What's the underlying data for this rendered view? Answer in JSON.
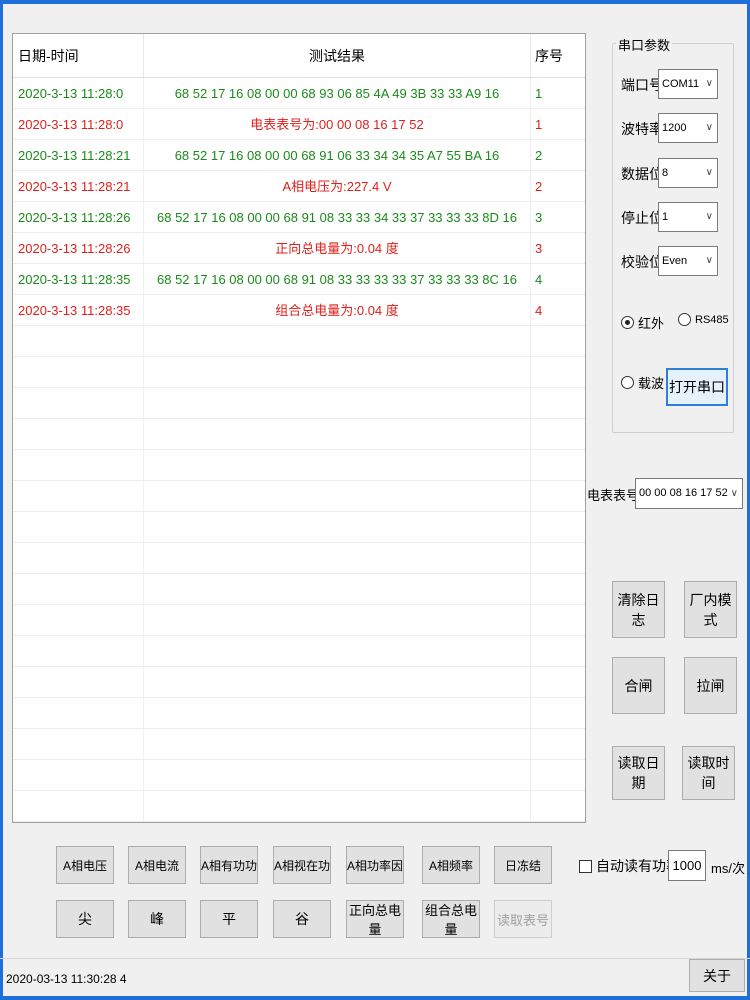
{
  "log": {
    "headers": {
      "date": "日期-时间",
      "result": "测试结果",
      "seq": "序号"
    },
    "rows": [
      {
        "date": "2020-3-13 11:28:0",
        "result": "68 52 17 16 08 00 00 68 93 06 85 4A 49 3B 33 33 A9 16",
        "seq": "1",
        "color": "green"
      },
      {
        "date": "2020-3-13 11:28:0",
        "result": "电表表号为:00 00 08 16 17 52",
        "seq": "1",
        "color": "red"
      },
      {
        "date": "2020-3-13 11:28:21",
        "result": "68 52 17 16 08 00 00 68 91 06 33 34 34 35 A7 55 BA 16",
        "seq": "2",
        "color": "green"
      },
      {
        "date": "2020-3-13 11:28:21",
        "result": "A相电压为:227.4 V",
        "seq": "2",
        "color": "red"
      },
      {
        "date": "2020-3-13 11:28:26",
        "result": "68 52 17 16 08 00 00 68 91 08 33 33 34 33 37 33 33 33 8D 16",
        "seq": "3",
        "color": "green"
      },
      {
        "date": "2020-3-13 11:28:26",
        "result": "正向总电量为:0.04 度",
        "seq": "3",
        "color": "red"
      },
      {
        "date": "2020-3-13 11:28:35",
        "result": "68 52 17 16 08 00 00 68 91 08 33 33 33 33 37 33 33 33 8C 16",
        "seq": "4",
        "color": "green"
      },
      {
        "date": "2020-3-13 11:28:35",
        "result": "组合总电量为:0.04 度",
        "seq": "4",
        "color": "red"
      }
    ]
  },
  "serial": {
    "group_title": "串口参数",
    "port_label": "端口号",
    "port_value": "COM11",
    "baud_label": "波特率",
    "baud_value": "1200",
    "databits_label": "数据位",
    "databits_value": "8",
    "stopbits_label": "停止位",
    "stopbits_value": "1",
    "parity_label": "校验位",
    "parity_value": "Even",
    "radio_infrared": "红外",
    "radio_rs485": "RS485",
    "radio_carrier": "载波",
    "open_button": "打开串口"
  },
  "meter": {
    "label": "电表表号:",
    "value": "00 00 08 16 17 52"
  },
  "side_buttons": {
    "clear_log": "清除日志",
    "factory_mode": "厂内模式",
    "close_switch": "合闸",
    "open_switch": "拉闸",
    "read_date": "读取日期",
    "read_time": "读取时间"
  },
  "bottom_buttons": {
    "row1": [
      "A相电压",
      "A相电流",
      "A相有功功",
      "A相视在功",
      "A相功率因",
      "A相频率",
      "日冻结"
    ],
    "row2": [
      "尖",
      "峰",
      "平",
      "谷",
      "正向总电量",
      "组合总电量",
      "读取表号"
    ]
  },
  "auto_read": {
    "label": "自动读有功率",
    "interval": "1000",
    "unit": "ms/次"
  },
  "status": {
    "text": "2020-03-13 11:30:28  4"
  },
  "about_button": "关于",
  "colors": {
    "green": "#1a8a1a",
    "red": "#e0201c",
    "accent": "#2f7fd6"
  }
}
